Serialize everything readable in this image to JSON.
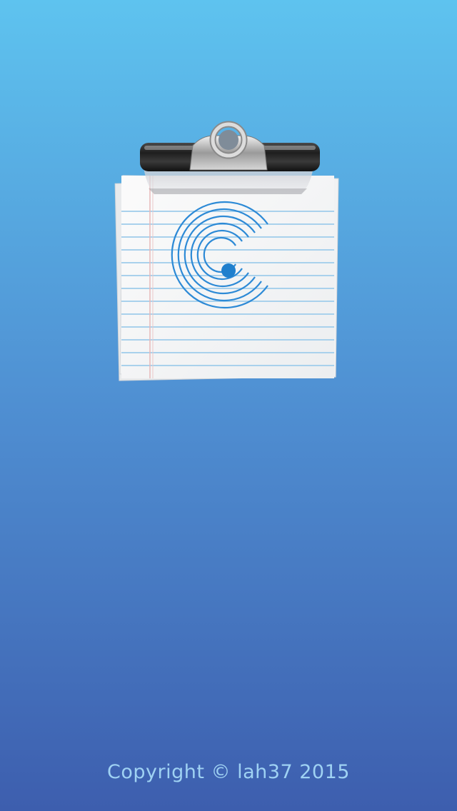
{
  "app": {
    "logo_icon": "clipboard-notepad-c-logo-icon",
    "background_top_color": "#5ec3ef",
    "background_bottom_color": "#3d5eae",
    "accent_color": "#2a86d6"
  },
  "footer": {
    "copyright": "Copyright © lah37 2015"
  }
}
